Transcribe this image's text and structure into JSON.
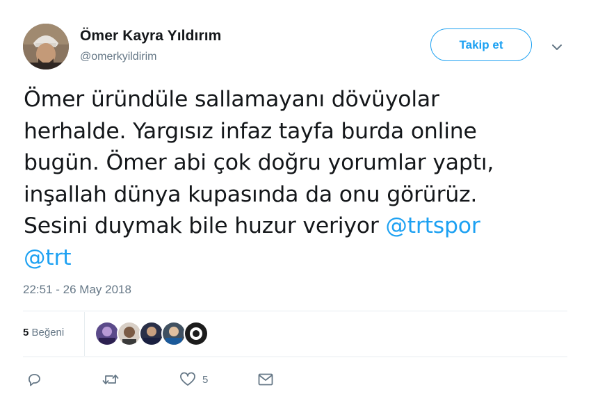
{
  "user": {
    "display_name": "Ömer Kayra Yıldırım",
    "handle": "@omerkyildirim"
  },
  "follow_button": {
    "label": "Takip et"
  },
  "tweet": {
    "lines": [
      {
        "text": "Ömer üründüle sallamayanı dövüyolar"
      },
      {
        "text": "herhalde. Yargısız infaz tayfa burda online"
      },
      {
        "text": "bugün. Ömer abi çok doğru yorumlar yaptı,"
      },
      {
        "text": "inşallah dünya kupasında da onu görürüz."
      },
      {
        "text": "Sesini duymak bile huzur veriyor ",
        "mention": "@trtspor"
      },
      {
        "mention": "@trt"
      }
    ]
  },
  "timestamp": "22:51 - 26 May 2018",
  "likes": {
    "count": "5",
    "label": "Beğeni"
  },
  "actions": {
    "like_count": "5",
    "icons": [
      "reply-icon",
      "retweet-icon",
      "heart-icon",
      "envelope-icon"
    ]
  },
  "colors": {
    "accent": "#1da1f2",
    "text": "#14171a",
    "muted": "#657786",
    "divider": "#e6ecf0"
  }
}
